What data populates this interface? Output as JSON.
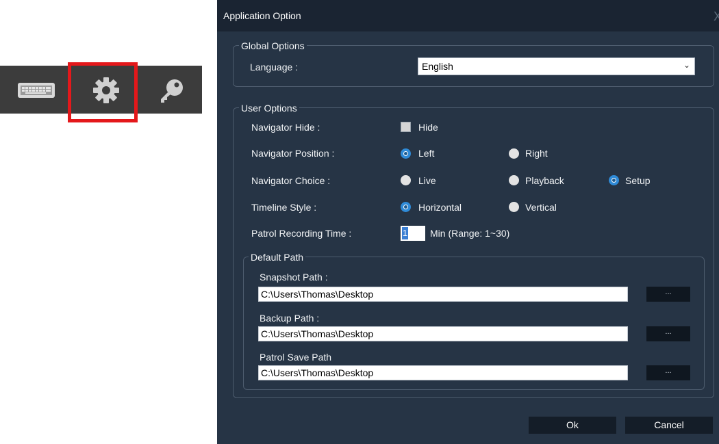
{
  "toolbar": {
    "icons": [
      "keyboard-icon",
      "gear-icon",
      "key-icon"
    ],
    "highlighted": "gear-icon",
    "highlight_color": "#e4181b"
  },
  "dialog": {
    "title": "Application Option",
    "close_glyph": "X",
    "global_options": {
      "legend": "Global Options",
      "language_label": "Language :",
      "language_value": "English"
    },
    "user_options": {
      "legend": "User Options",
      "navigator_hide": {
        "label": "Navigator Hide :",
        "checkbox_label": "Hide",
        "checked": false
      },
      "navigator_position": {
        "label": "Navigator Position :",
        "options": [
          "Left",
          "Right"
        ],
        "selected": "Left"
      },
      "navigator_choice": {
        "label": "Navigator Choice :",
        "options": [
          "Live",
          "Playback",
          "Setup"
        ],
        "selected": "Setup"
      },
      "timeline_style": {
        "label": "Timeline Style :",
        "options": [
          "Horizontal",
          "Vertical"
        ],
        "selected": "Horizontal"
      },
      "patrol_recording_time": {
        "label": "Patrol Recording Time :",
        "value": "1",
        "suffix": "Min (Range: 1~30)"
      }
    },
    "default_path": {
      "legend": "Default Path",
      "snapshot": {
        "label": "Snapshot Path :",
        "value": "C:\\Users\\Thomas\\Desktop",
        "browse": "..."
      },
      "backup": {
        "label": "Backup Path :",
        "value": "C:\\Users\\Thomas\\Desktop",
        "browse": "..."
      },
      "patrol_save": {
        "label": "Patrol Save Path",
        "value": "C:\\Users\\Thomas\\Desktop",
        "browse": "..."
      }
    },
    "ok_label": "Ok",
    "cancel_label": "Cancel",
    "colors": {
      "background": "#263445",
      "titlebar": "#1a2432",
      "radio_accent": "#2f8bd8"
    }
  }
}
